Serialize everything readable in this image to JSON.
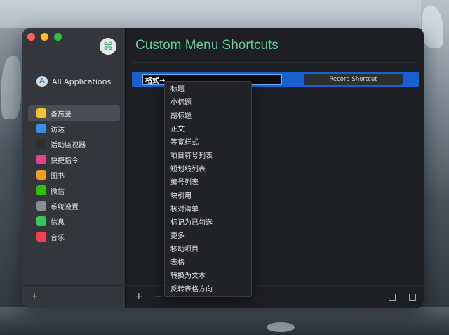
{
  "window": {
    "title": "Custom Menu Shortcuts",
    "logo_glyph": "⌘"
  },
  "sidebar": {
    "all_apps_label": "All Applications",
    "apps": [
      {
        "label": "备忘录",
        "icon": "notes-icon",
        "color": "#f5c12e",
        "selected": true
      },
      {
        "label": "访达",
        "icon": "finder-icon",
        "color": "#3a8ee6",
        "selected": false
      },
      {
        "label": "活动监视器",
        "icon": "activity-monitor-icon",
        "color": "#2e2e2e",
        "selected": false
      },
      {
        "label": "快捷指令",
        "icon": "shortcuts-icon",
        "color": "#e2428f",
        "selected": false
      },
      {
        "label": "图书",
        "icon": "books-icon",
        "color": "#f59a23",
        "selected": false
      },
      {
        "label": "微信",
        "icon": "wechat-icon",
        "color": "#2dc100",
        "selected": false
      },
      {
        "label": "系统设置",
        "icon": "system-settings-icon",
        "color": "#8a8d93",
        "selected": false
      },
      {
        "label": "信息",
        "icon": "messages-icon",
        "color": "#32c759",
        "selected": false
      },
      {
        "label": "音乐",
        "icon": "music-icon",
        "color": "#fa3c4c",
        "selected": false
      }
    ],
    "add_label": "+"
  },
  "row": {
    "input_value": "格式→",
    "record_label": "Record Shortcut"
  },
  "footer": {
    "add_label": "+",
    "remove_label": "−"
  },
  "menu": {
    "items": [
      "标题",
      "小标题",
      "副标题",
      "正文",
      "等宽样式",
      "项目符号列表",
      "短划线列表",
      "编号列表",
      "块引用",
      "核对清单",
      "标记为已勾选",
      "更多",
      "移动项目",
      "表格",
      "转换为文本",
      "反转表格方向"
    ]
  },
  "colors": {
    "accent": "#5fcf9a",
    "selection": "#1860d0"
  }
}
